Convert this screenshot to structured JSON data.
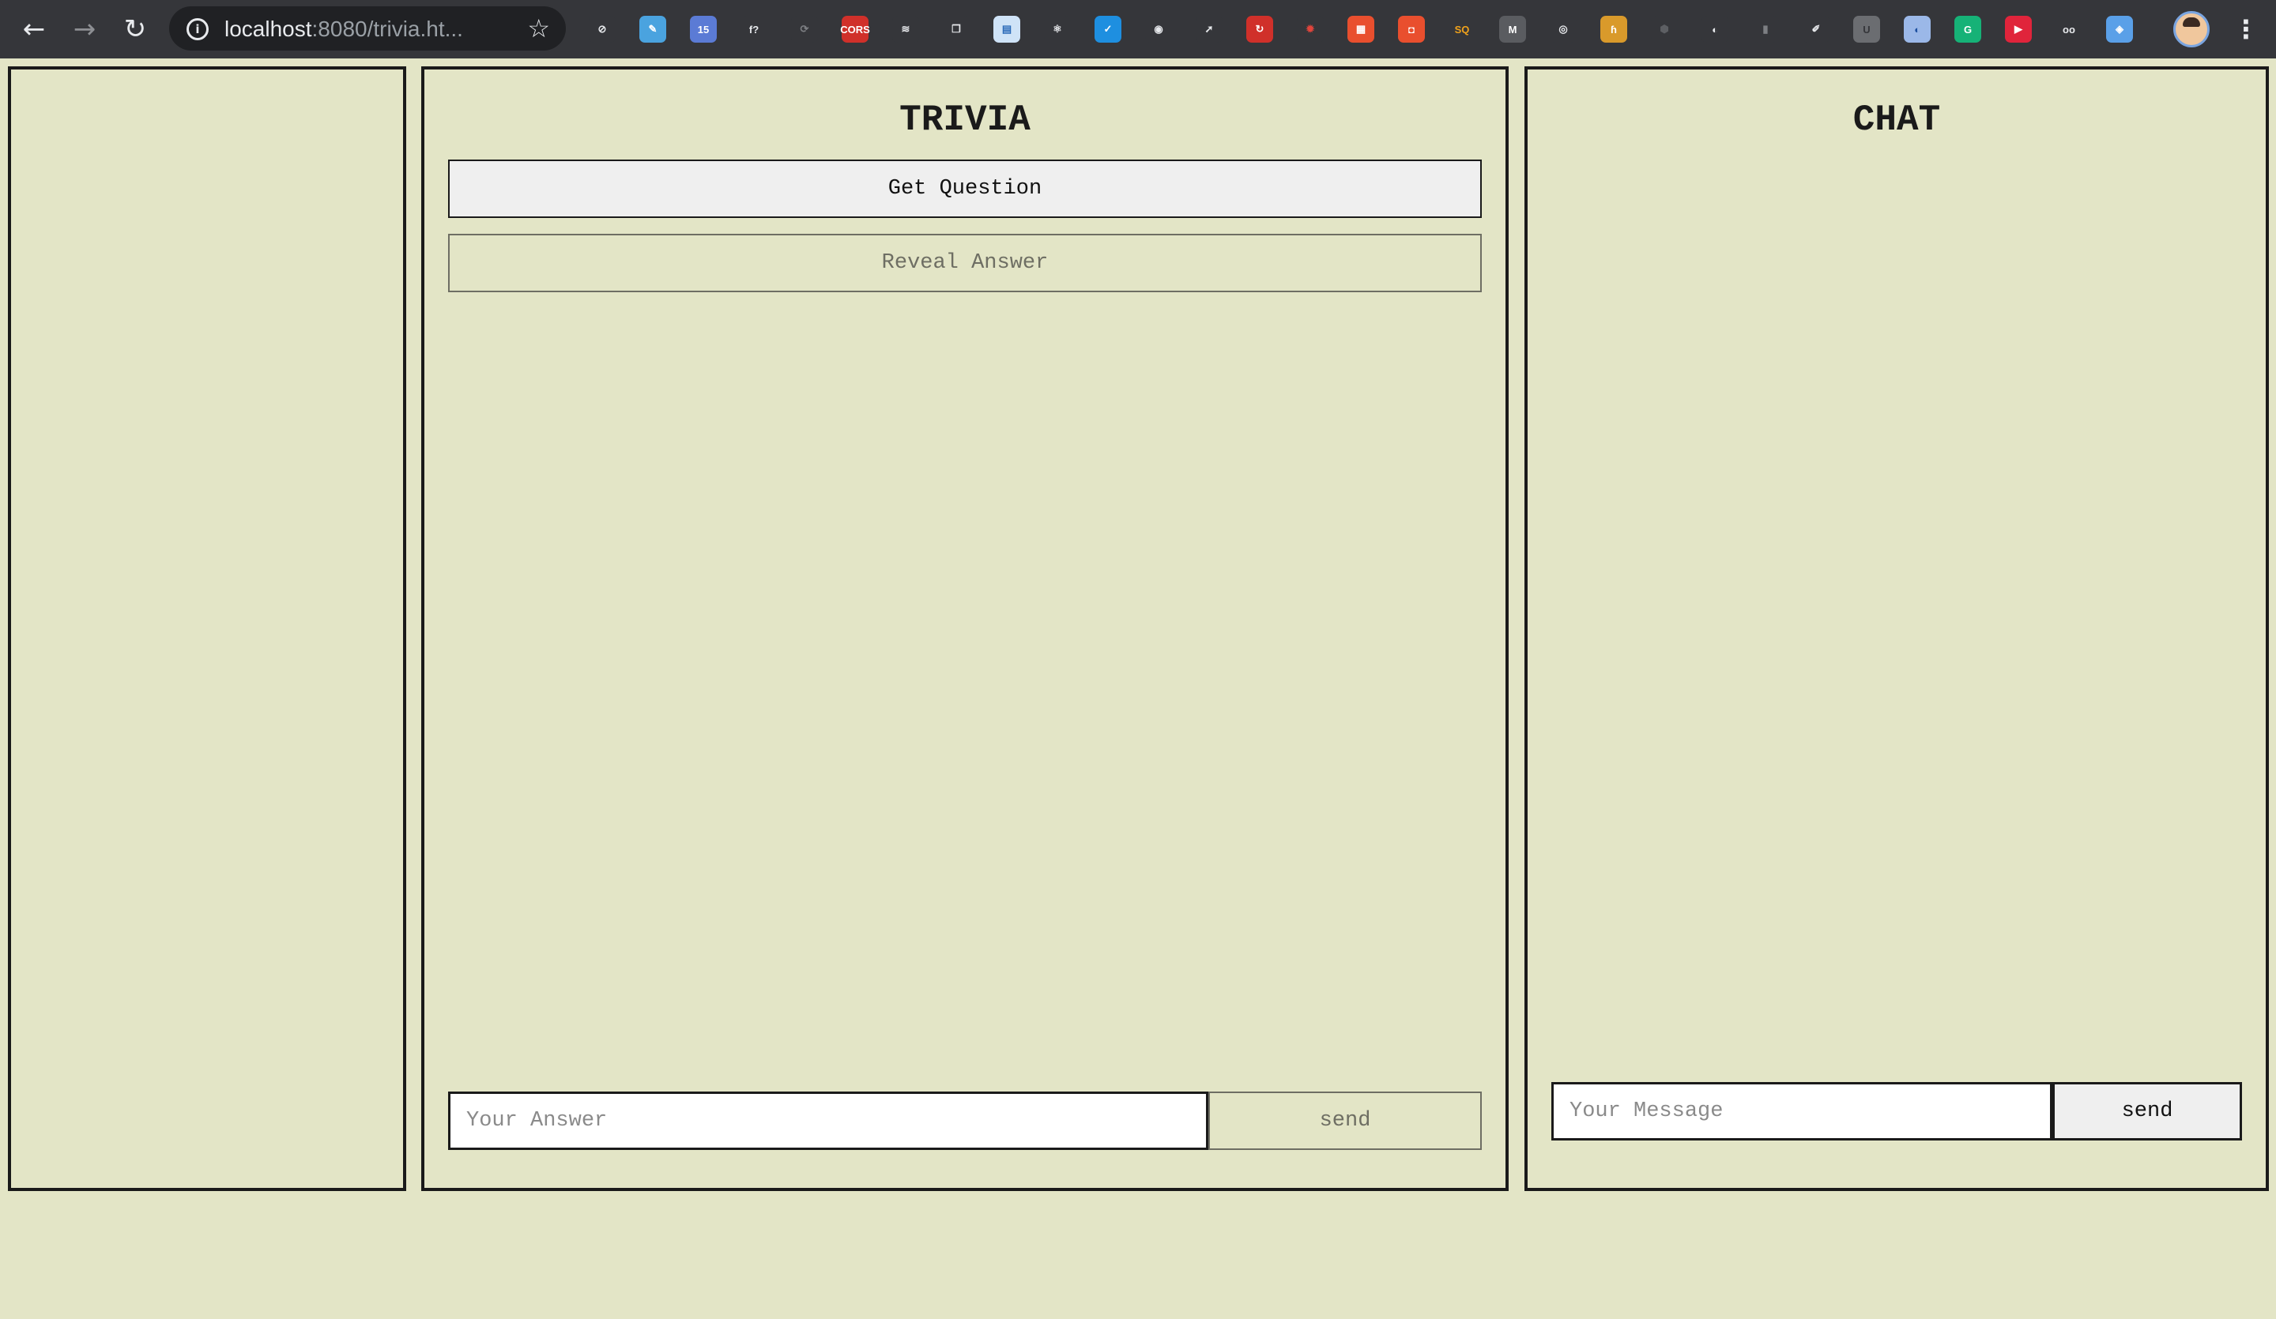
{
  "browser": {
    "url_host": "localhost",
    "url_rest": ":8080/trivia.ht...",
    "extensions": [
      {
        "icon": "compass-icon",
        "color": "#35363a",
        "label": "⊘",
        "text_color": "#e8eaed"
      },
      {
        "icon": "pen-icon",
        "color": "#4aa3df",
        "label": "✎",
        "text_color": "#ffffff"
      },
      {
        "icon": "calendar-icon",
        "color": "#5b7bd5",
        "label": "15",
        "text_color": "#ffffff"
      },
      {
        "icon": "function-icon",
        "color": "#35363a",
        "label": "f?",
        "text_color": "#e8eaed"
      },
      {
        "icon": "sync-icon",
        "color": "#35363a",
        "label": "⟳",
        "text_color": "#7d7f83"
      },
      {
        "icon": "cors-icon",
        "color": "#d0302a",
        "label": "CORS",
        "text_color": "#ffffff"
      },
      {
        "icon": "layers-icon",
        "color": "#35363a",
        "label": "≋",
        "text_color": "#e8eaed"
      },
      {
        "icon": "windows-icon",
        "color": "#35363a",
        "label": "❐",
        "text_color": "#e8eaed"
      },
      {
        "icon": "card-icon",
        "color": "#cfe3f7",
        "label": "▤",
        "text_color": "#2a6ab8"
      },
      {
        "icon": "react-icon",
        "color": "#35363a",
        "label": "⚛",
        "text_color": "#e8eaed"
      },
      {
        "icon": "check-icon",
        "color": "#1e8fe0",
        "label": "✓",
        "text_color": "#ffffff"
      },
      {
        "icon": "record-icon",
        "color": "#35363a",
        "label": "◉",
        "text_color": "#e8eaed"
      },
      {
        "icon": "cursor-icon",
        "color": "#35363a",
        "label": "➚",
        "text_color": "#e8eaed"
      },
      {
        "icon": "refresh-red-icon",
        "color": "#d0302a",
        "label": "↻",
        "text_color": "#ffffff"
      },
      {
        "icon": "bug-icon",
        "color": "#35363a",
        "label": "✹",
        "text_color": "#e0443b"
      },
      {
        "icon": "grid-icon",
        "color": "#e94f2e",
        "label": "▦",
        "text_color": "#ffffff"
      },
      {
        "icon": "gift-icon",
        "color": "#e94f2e",
        "label": "◘",
        "text_color": "#ffffff"
      },
      {
        "icon": "sq-icon",
        "color": "#35363a",
        "label": "SQ",
        "text_color": "#f0a21b"
      },
      {
        "icon": "gmail-icon",
        "color": "#5a5c60",
        "label": "M",
        "text_color": "#ffffff"
      },
      {
        "icon": "target-icon",
        "color": "#35363a",
        "label": "◎",
        "text_color": "#e8eaed"
      },
      {
        "icon": "h-icon",
        "color": "#d99a2b",
        "label": "ɦ",
        "text_color": "#ffffff"
      },
      {
        "icon": "hexagon-icon",
        "color": "#35363a",
        "label": "⬢",
        "text_color": "#5d5f63"
      },
      {
        "icon": "moon-icon",
        "color": "#35363a",
        "label": "◐",
        "text_color": "#e8eaed"
      },
      {
        "icon": "bars-icon",
        "color": "#35363a",
        "label": "▮",
        "text_color": "#7d7f83"
      },
      {
        "icon": "eyedropper-icon",
        "color": "#35363a",
        "label": "✐",
        "text_color": "#e8eaed"
      },
      {
        "icon": "u-icon",
        "color": "#6b6d71",
        "label": "U",
        "text_color": "#35363a"
      },
      {
        "icon": "shield-icon",
        "color": "#9bb8e8",
        "label": "◐",
        "text_color": "#1c4fa0"
      },
      {
        "icon": "grammarly-icon",
        "color": "#16b277",
        "label": "G",
        "text_color": "#ffffff"
      },
      {
        "icon": "video-icon",
        "color": "#e0243b",
        "label": "▶",
        "text_color": "#ffffff"
      },
      {
        "icon": "glasses-icon",
        "color": "#35363a",
        "label": "oo",
        "text_color": "#e8eaed"
      },
      {
        "icon": "diamond-icon",
        "color": "#5aa0e8",
        "label": "◈",
        "text_color": "#ffffff"
      }
    ]
  },
  "trivia": {
    "title": "TRIVIA",
    "get_question_label": "Get Question",
    "reveal_answer_label": "Reveal Answer",
    "answer_placeholder": "Your Answer",
    "send_label": "send"
  },
  "chat": {
    "title": "CHAT",
    "message_placeholder": "Your Message",
    "send_label": "send"
  }
}
